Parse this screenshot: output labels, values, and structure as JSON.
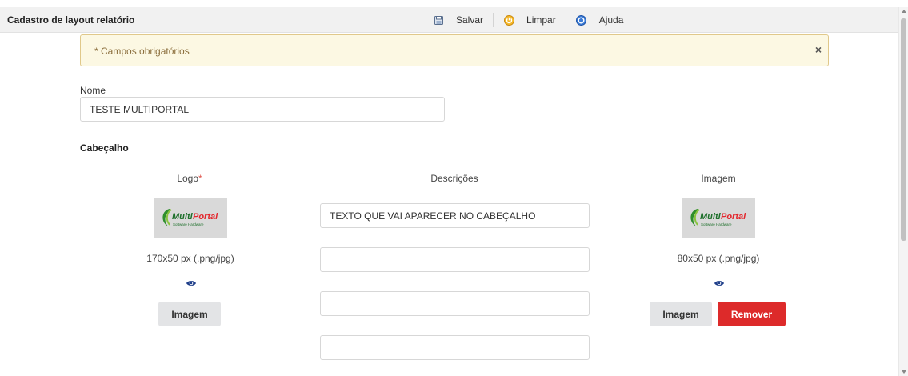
{
  "header": {
    "title": "Cadastro de layout relatório",
    "toolbar": {
      "save_label": "Salvar",
      "clear_label": "Limpar",
      "help_label": "Ajuda"
    }
  },
  "alert": {
    "text": "* Campos obrigatórios",
    "close_label": "×"
  },
  "form": {
    "name_label": "Nome",
    "name_value": "TESTE MULTIPORTAL",
    "section_title": "Cabeçalho",
    "logo": {
      "label": "Logo",
      "required_mark": "*",
      "size_hint": "170x50 px (.png/jpg)",
      "button_label": "Imagem"
    },
    "descriptions": {
      "label": "Descrições",
      "values": [
        "TEXTO QUE VAI APARECER NO CABEÇALHO",
        "",
        "",
        ""
      ]
    },
    "image": {
      "label": "Imagem",
      "size_hint": "80x50 px (.png/jpg)",
      "button_label": "Imagem",
      "remove_label": "Remover"
    }
  },
  "brand_logo": {
    "word1": "Multi",
    "word2": "Portal",
    "tagline": "Software Hardware"
  },
  "colors": {
    "alert_bg": "#fcf8e3",
    "alert_border": "#e0c88a",
    "remove_button": "#dd2a2a",
    "required_mark": "#e0584f"
  },
  "icons": {
    "save": "floppy-disk-icon",
    "clear": "power-icon",
    "help": "help-circle-icon",
    "preview": "eye-icon"
  }
}
